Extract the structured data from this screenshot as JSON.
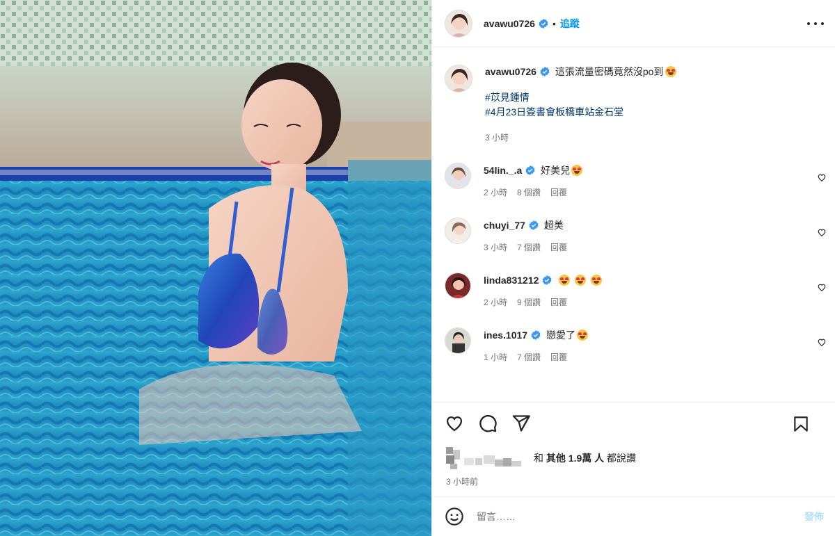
{
  "post": {
    "author": "avawu0726",
    "follow_label": "追蹤",
    "dot": "•",
    "caption": "這張流量密碼竟然沒po到",
    "hashtags": [
      "#苡見鍾情",
      "#4月23日簽書會板橋車站金石堂"
    ],
    "caption_time": "3 小時"
  },
  "comments": [
    {
      "user": "54lin._.a",
      "text": "好美兒",
      "emoji_count": 1,
      "time": "2 小時",
      "likes": "8 個讚",
      "reply": "回覆"
    },
    {
      "user": "chuyi_77",
      "text": "超美",
      "emoji_count": 0,
      "time": "3 小時",
      "likes": "7 個讚",
      "reply": "回覆"
    },
    {
      "user": "linda831212",
      "text": "",
      "emoji_count": 3,
      "time": "2 小時",
      "likes": "9 個讚",
      "reply": "回覆"
    },
    {
      "user": "ines.1017",
      "text": "戀愛了",
      "emoji_count": 1,
      "time": "1 小時",
      "likes": "7 個讚",
      "reply": "回覆"
    }
  ],
  "likes": {
    "prefix": "和",
    "others": "其他 1.9萬 人",
    "suffix": "都說讚"
  },
  "posted_ago": "3 小時前",
  "composer": {
    "placeholder": "留言……",
    "post_label": "發佈"
  },
  "colors": {
    "accent": "#0095f6",
    "verified": "#3897f0",
    "post_disabled": "#b2dffc"
  }
}
